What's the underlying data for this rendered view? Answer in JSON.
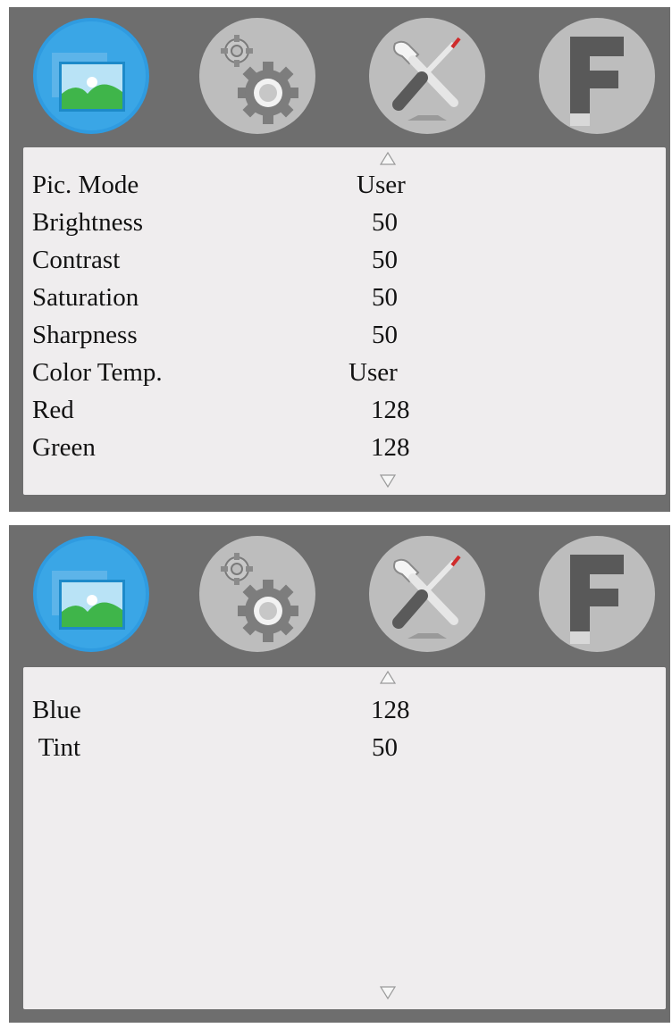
{
  "screens": [
    {
      "rows": [
        {
          "label": "Pic. Mode",
          "value": "User"
        },
        {
          "label": "Brightness",
          "value": "50"
        },
        {
          "label": "Contrast",
          "value": "50"
        },
        {
          "label": "Saturation",
          "value": "50"
        },
        {
          "label": "Sharpness",
          "value": "50"
        },
        {
          "label": "Color Temp.",
          "value": "User"
        },
        {
          "label": "Red",
          "value": "128"
        },
        {
          "label": "Green",
          "value": "128"
        }
      ]
    },
    {
      "rows": [
        {
          "label": "Blue",
          "value": "128"
        },
        {
          "label": " Tint",
          "value": "50"
        }
      ]
    }
  ],
  "tabs": [
    {
      "icon": "picture-icon",
      "active": true
    },
    {
      "icon": "gears-icon",
      "active": false
    },
    {
      "icon": "tools-icon",
      "active": false
    },
    {
      "icon": "f-letter-icon",
      "active": false
    }
  ],
  "colors": {
    "panel_bg": "#6e6e6e",
    "list_bg": "#efedee",
    "active_tab": "#2f9be0",
    "inactive_tab": "#bdbdbd"
  }
}
